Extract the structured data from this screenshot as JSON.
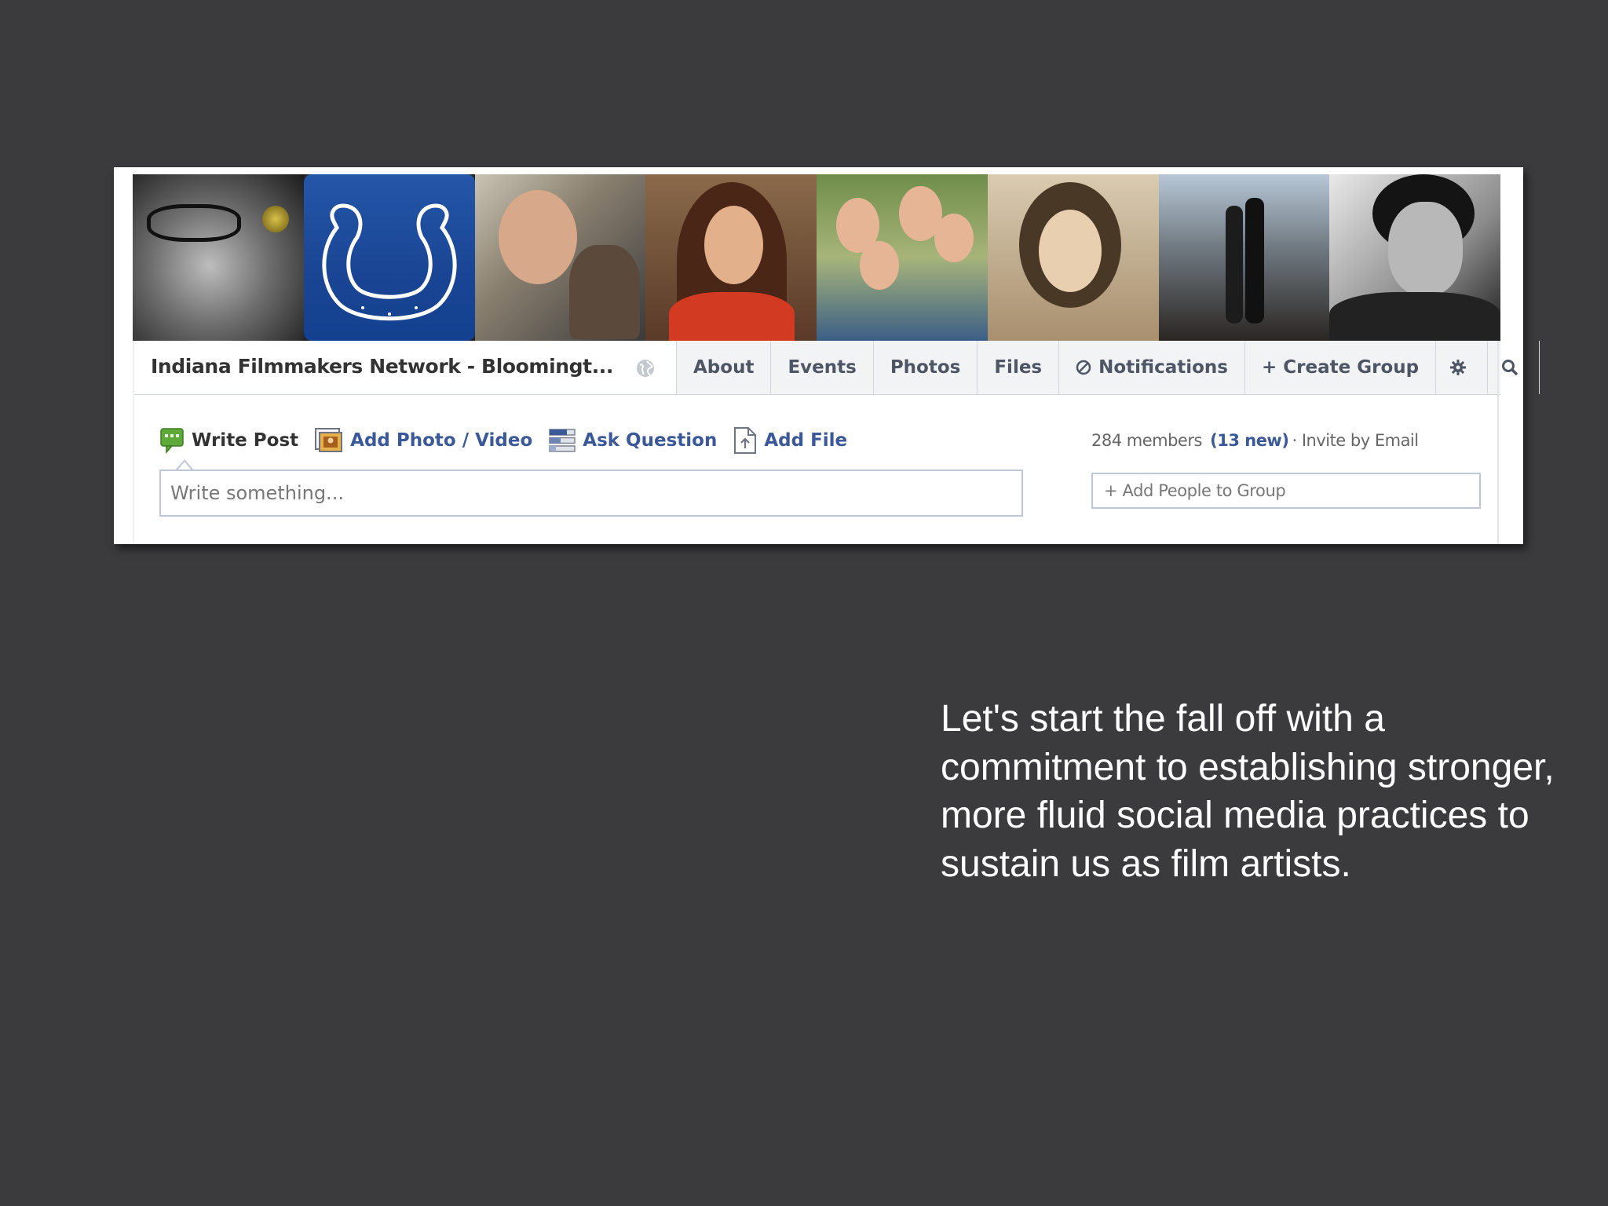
{
  "group": {
    "title": "Indiana Filmmakers Network - Bloomingt...",
    "privacy_icon": "globe-icon"
  },
  "tabs": [
    {
      "label": "About"
    },
    {
      "label": "Events"
    },
    {
      "label": "Photos"
    },
    {
      "label": "Files"
    },
    {
      "label": "Notifications",
      "icon": "no-symbol-icon"
    },
    {
      "label": "+ Create Group"
    }
  ],
  "tab_icons": [
    "gear-icon",
    "search-icon"
  ],
  "composer": {
    "actions": [
      {
        "label": "Write Post",
        "icon": "speech-bubble-icon"
      },
      {
        "label": "Add Photo / Video",
        "icon": "photo-icon"
      },
      {
        "label": "Ask Question",
        "icon": "poll-icon"
      },
      {
        "label": "Add File",
        "icon": "file-icon"
      }
    ],
    "placeholder": "Write something..."
  },
  "members": {
    "count_text": "284 members",
    "new_text": "(13 new)",
    "separator": "·",
    "invite_text": "Invite by Email",
    "add_people": "+ Add People to Group"
  },
  "caption": "Let's start the fall off with a commitment to establishing stronger, more fluid social media practices to sustain us as film artists.",
  "colors": {
    "background": "#3b3a3c",
    "link_blue": "#3b5998",
    "tab_bg": "#f2f3f5",
    "colts_blue": "#1a4594"
  }
}
